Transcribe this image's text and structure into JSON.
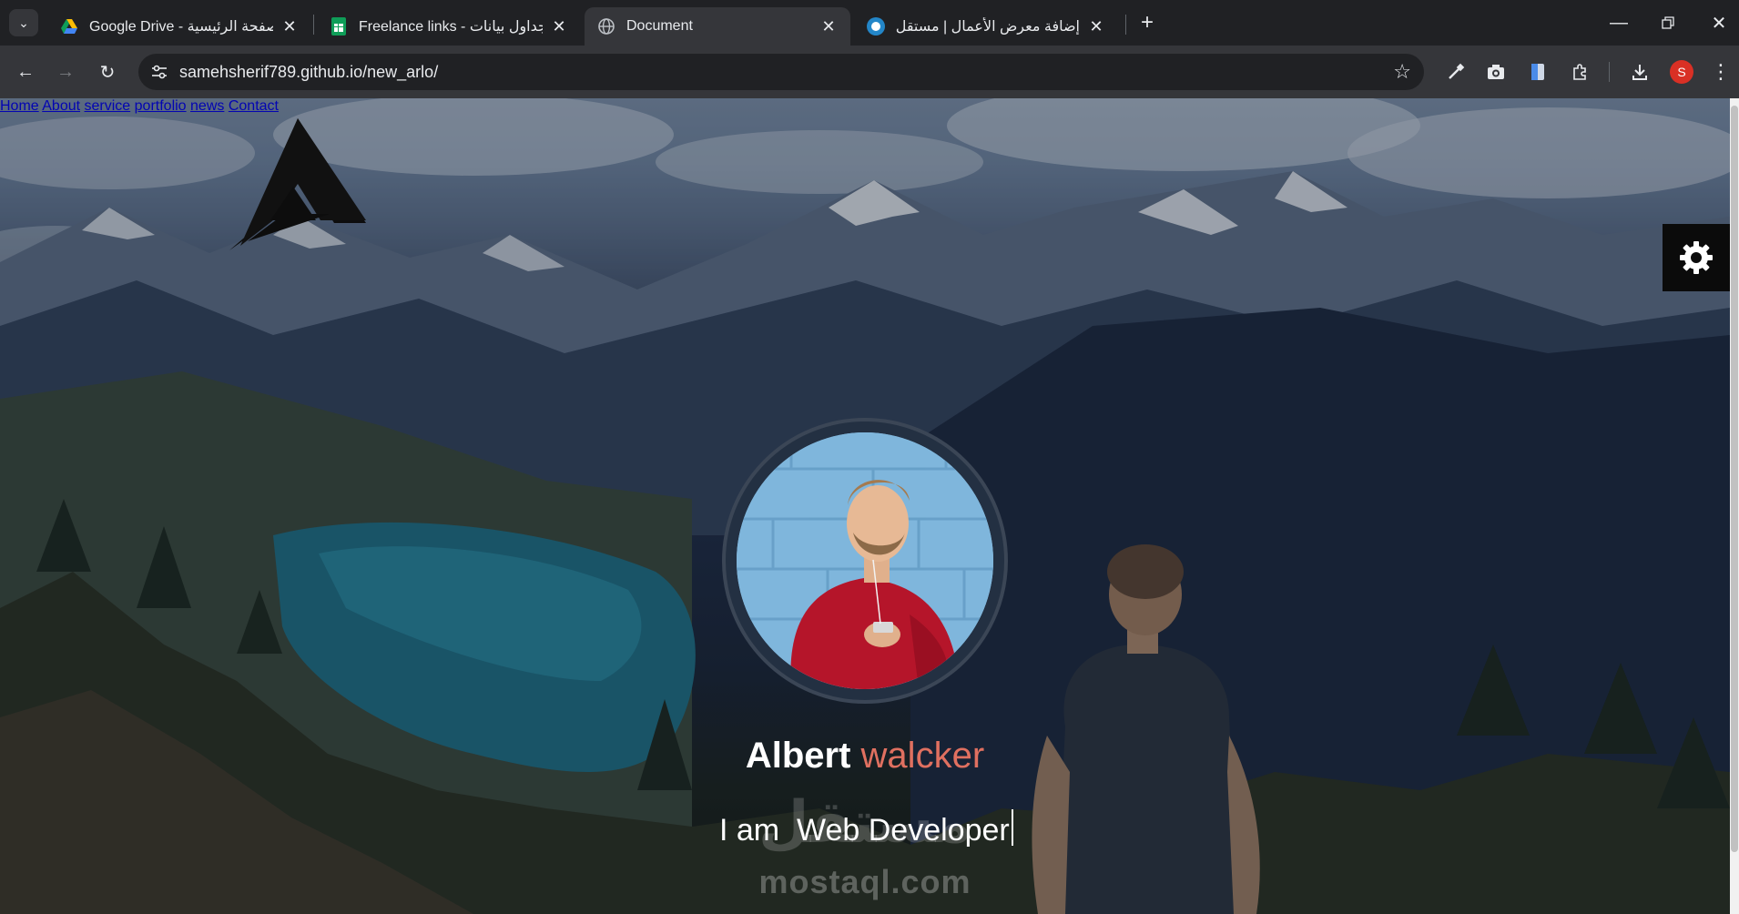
{
  "browser": {
    "tabs": [
      {
        "title": "Google Drive - الصفحة الرئيسية",
        "icon": "google-drive-icon",
        "active": false
      },
      {
        "title": "Freelance links - جداول بيانات Go",
        "icon": "google-sheets-icon",
        "active": false
      },
      {
        "title": "Document",
        "icon": "globe-icon",
        "active": true
      },
      {
        "title": "إضافة معرض الأعمال | مستقل",
        "icon": "mostaql-icon",
        "active": false
      }
    ],
    "url": {
      "host": "samehsherif789.github.io",
      "path": "/new_arlo/"
    },
    "profile_initial": "S"
  },
  "page": {
    "nav": [
      "Home",
      "About",
      "service",
      "portfolio",
      "news",
      "Contact"
    ],
    "name_first": "Albert",
    "name_last": "walcker",
    "role_text": "I am  Web Developer",
    "watermark": "mostaql.com",
    "watermark_ar": "مستقل",
    "accent_color": "#e07060"
  }
}
